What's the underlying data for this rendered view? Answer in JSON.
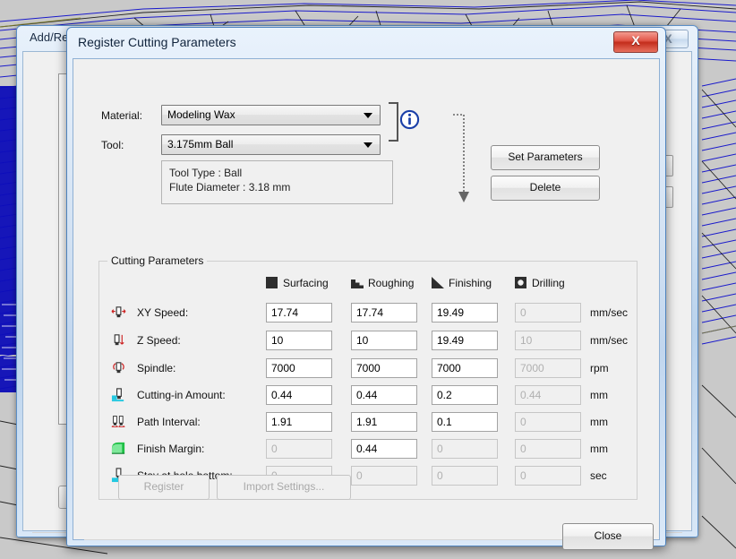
{
  "background_window": {
    "title": "Add/Re",
    "close_label": "X",
    "list_row_count": 15,
    "list_icon": "prohibited-icon",
    "selected_row_index": 14
  },
  "dialog": {
    "title": "Register Cutting Parameters",
    "close_label": "X",
    "material": {
      "label": "Material:",
      "value": "Modeling Wax",
      "icon": "chevron-down-icon"
    },
    "tool": {
      "label": "Tool:",
      "value": "3.175mm Ball",
      "icon": "chevron-down-icon"
    },
    "info_icon": "info-icon",
    "tool_info": {
      "line1": "Tool Type : Ball",
      "line2": "Flute Diameter : 3.18 mm"
    },
    "actions": {
      "set_parameters": "Set Parameters",
      "delete": "Delete",
      "register": "Register",
      "import_settings": "Import Settings...",
      "close": "Close",
      "register_enabled": false,
      "import_settings_enabled": false
    },
    "cutting_parameters": {
      "group_title": "Cutting Parameters",
      "columns": [
        {
          "label": "Surfacing",
          "icon": "filled-square-icon"
        },
        {
          "label": "Roughing",
          "icon": "staircase-icon"
        },
        {
          "label": "Finishing",
          "icon": "triangle-icon"
        },
        {
          "label": "Drilling",
          "icon": "drill-hole-icon"
        }
      ],
      "rows": [
        {
          "label": "XY Speed:",
          "icon": "xy-speed-icon",
          "unit": "mm/sec",
          "values": [
            "17.74",
            "17.74",
            "19.49",
            "0"
          ],
          "enabled": [
            true,
            true,
            true,
            false
          ]
        },
        {
          "label": "Z Speed:",
          "icon": "z-speed-icon",
          "unit": "mm/sec",
          "values": [
            "10",
            "10",
            "19.49",
            "10"
          ],
          "enabled": [
            true,
            true,
            true,
            false
          ]
        },
        {
          "label": "Spindle:",
          "icon": "spindle-icon",
          "unit": "rpm",
          "values": [
            "7000",
            "7000",
            "7000",
            "7000"
          ],
          "enabled": [
            true,
            true,
            true,
            false
          ]
        },
        {
          "label": "Cutting-in Amount:",
          "icon": "cutting-in-amount-icon",
          "unit": "mm",
          "values": [
            "0.44",
            "0.44",
            "0.2",
            "0.44"
          ],
          "enabled": [
            true,
            true,
            true,
            false
          ]
        },
        {
          "label": "Path Interval:",
          "icon": "path-interval-icon",
          "unit": "mm",
          "values": [
            "1.91",
            "1.91",
            "0.1",
            "0"
          ],
          "enabled": [
            true,
            true,
            true,
            false
          ]
        },
        {
          "label": "Finish Margin:",
          "icon": "finish-margin-icon",
          "unit": "mm",
          "values": [
            "0",
            "0.44",
            "0",
            "0"
          ],
          "enabled": [
            false,
            true,
            false,
            false
          ]
        },
        {
          "label": "Stay at hole bottom:",
          "icon": "stay-at-hole-bottom-icon",
          "unit": "sec",
          "values": [
            "0",
            "0",
            "0",
            "0"
          ],
          "enabled": [
            false,
            false,
            false,
            false
          ]
        }
      ]
    }
  },
  "colors": {
    "accent_blue": "#2a8ade",
    "close_red": "#c32d1c",
    "info_blue": "#1a3fa8",
    "icon_red": "#cc2222",
    "icon_cyan": "#24c8e0",
    "icon_green": "#1fbf45",
    "mesh_blue": "#1111cc"
  }
}
